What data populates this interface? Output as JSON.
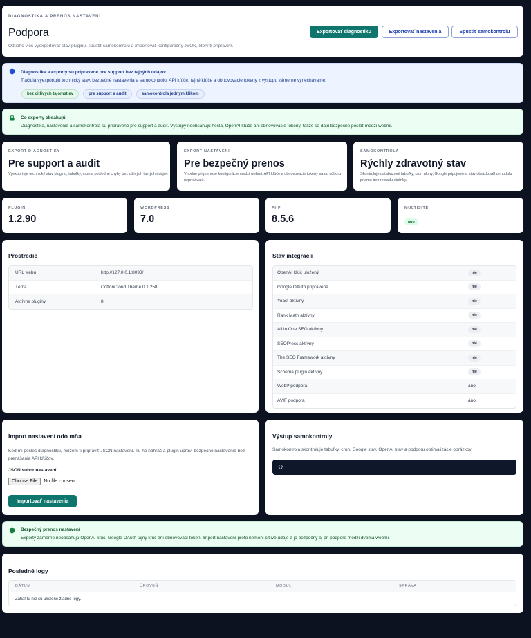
{
  "header": {
    "eyebrow": "DIAGNOSTIKA A PRENOS NASTAVENÍ",
    "title": "Podpora",
    "subtitle": "Odtiaľto vieš vyexportovať stav pluginu, spustiť samokontrolu a importovať konfiguračný JSON, ktorý ti pripravím.",
    "buttons": {
      "export_diag": "Exportovať diagnostiku",
      "export_settings": "Exportovať nastavenia",
      "run_check": "Spustiť samokontrolu"
    }
  },
  "notice_info": {
    "title": "Diagnostika a exporty sú pripravené pre support bez tajných údajov.",
    "text": "Tlačidlá vyexportujú technický stav, bezpečné nastavenia a samokontrolu. API kľúče, tajné kľúče a obnovovacie tokeny z výstupu zámerne vynechávame.",
    "chips": [
      "bez citlivých tajomstiev",
      "pre support a audit",
      "samokontrola jedným klikom"
    ]
  },
  "notice_exports": {
    "title": "Čo exporty obsahujú",
    "text": "Diagnostika, nastavenia a samokontrola sú pripravené pre support a audit. Výstupy neobsahujú heslá, OpenAI kľúče ani obnovovacie tokeny, takže sa dajú bezpečne poslať medzi webmi."
  },
  "feature_cards": [
    {
      "label": "EXPORT DIAGNOSTIKY",
      "title": "Pre support a audit",
      "text": "Vyexportuje technický stav pluginu, tabuľky, cron a posledné chyby bez citlivých tajných údajov."
    },
    {
      "label": "EXPORT NASTAVENÍ",
      "title": "Pre bezpečný prenos",
      "text": "Vhodné pri prenose konfigurácie medzi webmi. API kľúče a obnovovacie tokeny sa do súboru nepridávajú."
    },
    {
      "label": "SAMOKONTROLA",
      "title": "Rýchly zdravotný stav",
      "text": "Skontroluje databázové tabuľky, cron úlohy, Google pripojenie a stav obrázkového modulu priamo bez reloadu stránky."
    }
  ],
  "stats": [
    {
      "label": "PLUGIN",
      "value": "1.2.90"
    },
    {
      "label": "WORDPRESS",
      "value": "7.0"
    },
    {
      "label": "PHP",
      "value": "8.5.6"
    },
    {
      "label": "MULTISITE",
      "value": "áno"
    }
  ],
  "environment": {
    "title": "Prostredie",
    "rows": [
      {
        "key": "URL webu",
        "value": "http://127.0.0.1:8093/"
      },
      {
        "key": "Téma",
        "value": "CottonCloud Theme 0.1.258"
      },
      {
        "key": "Aktívne pluginy",
        "value": "8"
      }
    ]
  },
  "integrations": {
    "title": "Stav integrácií",
    "rows": [
      {
        "key": "OpenAI kľúč uložený",
        "value": "nie",
        "pill": true
      },
      {
        "key": "Google OAuth pripravené",
        "value": "nie",
        "pill": true
      },
      {
        "key": "Yoast aktívny",
        "value": "nie",
        "pill": true
      },
      {
        "key": "Rank Math aktívny",
        "value": "nie",
        "pill": true
      },
      {
        "key": "All in One SEO aktívny",
        "value": "nie",
        "pill": true
      },
      {
        "key": "SEOPress aktívny",
        "value": "nie",
        "pill": true
      },
      {
        "key": "The SEO Framework aktívny",
        "value": "nie",
        "pill": true
      },
      {
        "key": "Schema plugin aktívny",
        "value": "nie",
        "pill": true
      },
      {
        "key": "WebP podpora",
        "value": "áno",
        "pill": false
      },
      {
        "key": "AVIF podpora",
        "value": "áno",
        "pill": false
      }
    ]
  },
  "import": {
    "title": "Import nastavení odo mňa",
    "text": "Keď mi pošleš diagnostiku, môžem ti pripraviť JSON nastavení. Tu ho nahráš a plugin upraví bezpečné nastavenia bez prenášania API kľúčov.",
    "file_label": "JSON súbor nastavení",
    "file_button": "Choose File",
    "file_status": "No file chosen",
    "submit": "Importovať nastavenia"
  },
  "selfcheck": {
    "title": "Výstup samokontroly",
    "text": "Samokontrola skontroluje tabuľky, cron, Google stav, OpenAI stav a podporu optimalizácie obrázkov.",
    "output": "{}"
  },
  "notice_transfer": {
    "title": "Bezpečný prenos nastavení",
    "text": "Exporty zámerne neobsahujú OpenAI kľúč, Google OAuth tajný kľúč ani obnovovací token. Import nastavení preto nemení citlivé údaje a je bezpečný aj pri podpore medzi dvoma webmi."
  },
  "logs": {
    "title": "Posledné logy",
    "columns": [
      "DÁTUM",
      "ÚROVEŇ",
      "MODUL",
      "SPRÁVA"
    ],
    "empty": "Zatiaľ tu nie sú uložené žiadne logy."
  },
  "colors": {
    "accent": "#0f766e",
    "link": "#1e40af",
    "background": "#0c1220"
  }
}
